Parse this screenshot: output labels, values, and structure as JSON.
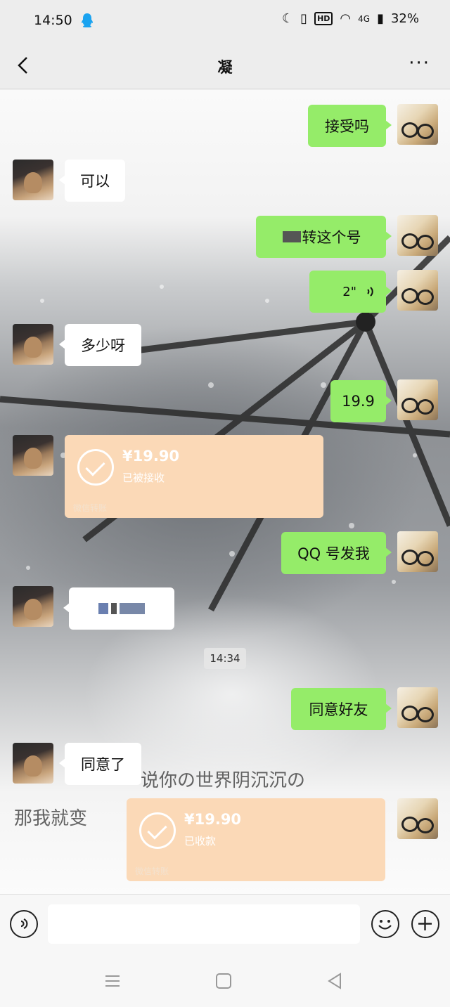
{
  "status_bar": {
    "time": "14:50",
    "battery": "32%",
    "network": "4G",
    "hd_badge": "HD"
  },
  "header": {
    "title": "凝",
    "more": "···"
  },
  "messages": [
    {
      "side": "mine",
      "text": "接受吗"
    },
    {
      "side": "theirs",
      "text": "可以"
    },
    {
      "side": "mine",
      "text": "转这个号"
    },
    {
      "side": "mine",
      "type": "voice",
      "text": "2\""
    },
    {
      "side": "theirs",
      "text": "多少呀"
    },
    {
      "side": "mine",
      "text": "19.9"
    },
    {
      "side": "theirs",
      "type": "transfer",
      "amount": "¥19.90",
      "status": "已被接收",
      "footer": "微信转账"
    },
    {
      "side": "mine",
      "text": "QQ 号发我"
    },
    {
      "side": "theirs",
      "type": "redacted"
    },
    {
      "type": "timestamp",
      "text": "14:34"
    },
    {
      "side": "mine",
      "text": "同意好友"
    },
    {
      "side": "theirs",
      "text": "同意了"
    },
    {
      "side": "mine",
      "type": "transfer",
      "amount": "¥19.90",
      "status": "已收款",
      "footer": "微信转账"
    }
  ],
  "wallpaper_text": {
    "line1": "说你の世界阴沉沉の",
    "line2": "那我就变"
  },
  "colors": {
    "mine_bubble": "#95ec69",
    "theirs_bubble": "#ffffff",
    "transfer": "#fbd9b7",
    "background": "#ededed"
  },
  "icons": {
    "back": "chevron-left-icon",
    "voice_input": "voice-icon",
    "emoji": "emoji-icon",
    "plus": "plus-icon"
  }
}
